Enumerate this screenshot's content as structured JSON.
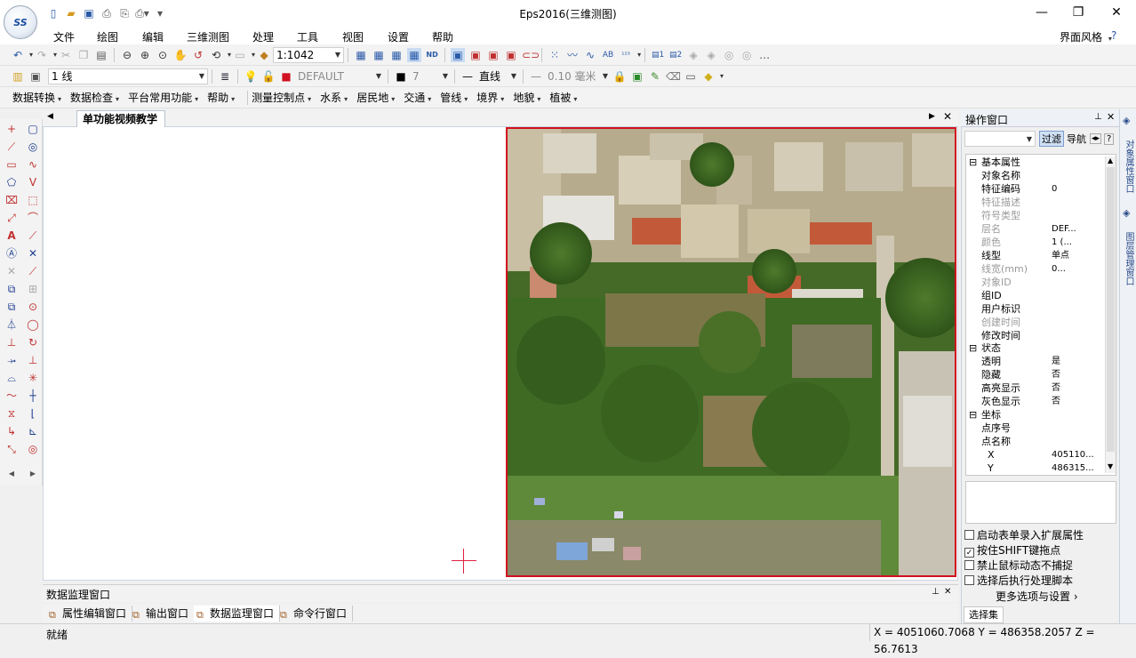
{
  "app": {
    "title": "Eps2016(三维测图)",
    "logo_text": "SS"
  },
  "window_controls": {
    "minimize": "—",
    "restore": "❐",
    "close": "✕"
  },
  "menu": [
    "文件",
    "绘图",
    "编辑",
    "三维测图",
    "处理",
    "工具",
    "视图",
    "设置",
    "帮助"
  ],
  "ui_style_label": "界面风格",
  "toolbar1": {
    "scale": "1:1042"
  },
  "toolbar2": {
    "line_type": "1 线",
    "layer": "DEFAULT",
    "color_num": "7",
    "line_style": "直线",
    "line_width": "0.10 毫米"
  },
  "toolbar3": [
    "数据转换",
    "数据检查",
    "平台常用功能",
    "帮助",
    "测量控制点",
    "水系",
    "居民地",
    "交通",
    "管线",
    "境界",
    "地貌",
    "植被"
  ],
  "document": {
    "tab_label": "单功能视频教学"
  },
  "monitor_title": "数据监理窗口",
  "bottom_tabs": [
    "属性编辑窗口",
    "输出窗口",
    "数据监理窗口",
    "命令行窗口"
  ],
  "status": {
    "left": "就绪",
    "coords": "X = 4051060.7068 Y = 486358.2057 Z = 56.7613"
  },
  "op_window": {
    "title": "操作窗口",
    "filter_btn": "过滤",
    "nav_btn": "导航",
    "categories": {
      "basic": "基本属性",
      "state": "状态",
      "coord": "坐标"
    },
    "basic_props": [
      {
        "name": "对象名称",
        "value": "",
        "gray": false
      },
      {
        "name": "特征编码",
        "value": "0",
        "gray": false
      },
      {
        "name": "特征描述",
        "value": "",
        "gray": true
      },
      {
        "name": "符号类型",
        "value": "",
        "gray": true
      },
      {
        "name": "层名",
        "value": "DEF...",
        "gray": true
      },
      {
        "name": "颜色",
        "value": "1 (...",
        "gray": true
      },
      {
        "name": "线型",
        "value": "单点",
        "gray": false
      },
      {
        "name": "线宽(mm)",
        "value": "0...",
        "gray": true
      },
      {
        "name": "对象ID",
        "value": "",
        "gray": true
      },
      {
        "name": "组ID",
        "value": "",
        "gray": false
      },
      {
        "name": "用户标识",
        "value": "",
        "gray": false
      },
      {
        "name": "创建时间",
        "value": "",
        "gray": true
      },
      {
        "name": "修改时间",
        "value": "",
        "gray": false
      }
    ],
    "state_props": [
      {
        "name": "透明",
        "value": "是"
      },
      {
        "name": "隐藏",
        "value": "否"
      },
      {
        "name": "高亮显示",
        "value": "否"
      },
      {
        "name": "灰色显示",
        "value": "否"
      }
    ],
    "coord_props": [
      {
        "name": "点序号",
        "value": ""
      },
      {
        "name": "点名称",
        "value": ""
      },
      {
        "name": "X",
        "value": "405110..."
      },
      {
        "name": "Y",
        "value": "486315..."
      }
    ],
    "checkboxes": [
      {
        "label": "启动表单录入扩展属性",
        "checked": false
      },
      {
        "label": "按住SHIFT键拖点",
        "checked": true
      },
      {
        "label": "禁止鼠标动态不捕捉",
        "checked": false
      },
      {
        "label": "选择后执行处理脚本",
        "checked": false
      }
    ],
    "more_link": "更多选项与设置",
    "selection_label": "选择集"
  },
  "side_tabs": [
    "对象属性窗口",
    "图层管理窗口"
  ],
  "colors": {
    "photo_border": "#d01020",
    "accent": "#2b5aa8"
  }
}
